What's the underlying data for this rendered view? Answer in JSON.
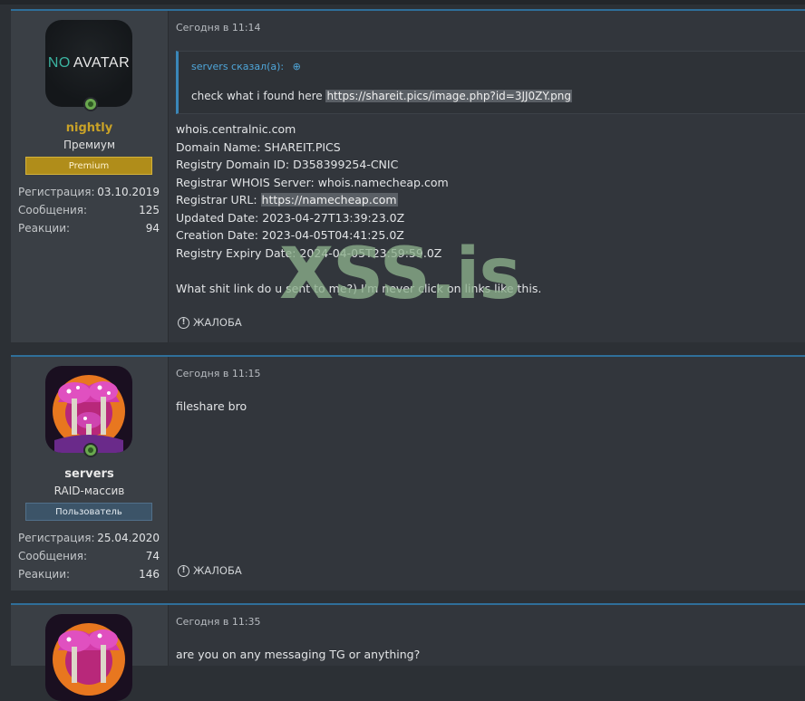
{
  "posts": [
    {
      "author": "nightly",
      "author_color": "#c9a227",
      "avatar": "NO AVATAR",
      "avatar_no": "NO",
      "avatar_text": "AVATAR",
      "title": "Премиум",
      "badge": "Premium",
      "stats": [
        {
          "k": "Регистрация:",
          "v": "03.10.2019"
        },
        {
          "k": "Сообщения:",
          "v": "125"
        },
        {
          "k": "Реакции:",
          "v": "94"
        }
      ],
      "date": "Сегодня в 11:14",
      "quote": {
        "head": "servers сказал(а):",
        "text": "check what i found here ",
        "link": "https://shareit.pics/image.php?id=3JJ0ZY.png"
      },
      "lines": [
        "whois.centralnic.com",
        "Domain Name: SHAREIT.PICS",
        "Registry Domain ID: D358399254-CNIC",
        "Registrar WHOIS Server: whois.namecheap.com"
      ],
      "registrar_url_label": "Registrar URL: ",
      "registrar_url": "https://namecheap.com",
      "lines2": [
        "Updated Date: 2023-04-27T13:39:23.0Z",
        "Creation Date: 2023-04-05T04:41:25.0Z",
        "Registry Expiry Date: 2024-04-05T23:59:59.0Z"
      ],
      "reply": "What shit link do u sent to me?) I'm never click on links like this.",
      "report": "ЖАЛОБА"
    },
    {
      "author": "servers",
      "author_color": "#e8e8e8",
      "title": "RAID-массив",
      "badge": "Пользователь",
      "stats": [
        {
          "k": "Регистрация:",
          "v": "25.04.2020"
        },
        {
          "k": "Сообщения:",
          "v": "74"
        },
        {
          "k": "Реакции:",
          "v": "146"
        }
      ],
      "date": "Сегодня в 11:15",
      "text": "fileshare bro",
      "report": "ЖАЛОБА"
    },
    {
      "date": "Сегодня в 11:35",
      "text": "are you on any messaging TG or anything?"
    }
  ],
  "watermark": "XSS.is",
  "colors": {
    "accent": "#2f6f9a",
    "link": "#4fa6d9",
    "premium": "#b08d1a"
  }
}
